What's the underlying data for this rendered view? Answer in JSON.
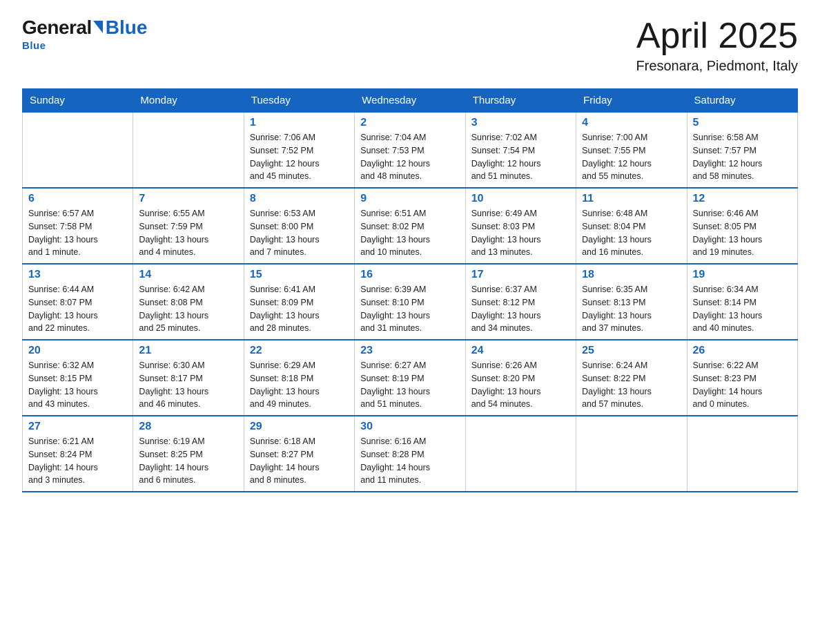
{
  "logo": {
    "general": "General",
    "blue": "Blue",
    "tagline": "Blue"
  },
  "header": {
    "month": "April 2025",
    "location": "Fresonara, Piedmont, Italy"
  },
  "weekdays": [
    "Sunday",
    "Monday",
    "Tuesday",
    "Wednesday",
    "Thursday",
    "Friday",
    "Saturday"
  ],
  "weeks": [
    [
      {
        "day": "",
        "info": ""
      },
      {
        "day": "",
        "info": ""
      },
      {
        "day": "1",
        "info": "Sunrise: 7:06 AM\nSunset: 7:52 PM\nDaylight: 12 hours\nand 45 minutes."
      },
      {
        "day": "2",
        "info": "Sunrise: 7:04 AM\nSunset: 7:53 PM\nDaylight: 12 hours\nand 48 minutes."
      },
      {
        "day": "3",
        "info": "Sunrise: 7:02 AM\nSunset: 7:54 PM\nDaylight: 12 hours\nand 51 minutes."
      },
      {
        "day": "4",
        "info": "Sunrise: 7:00 AM\nSunset: 7:55 PM\nDaylight: 12 hours\nand 55 minutes."
      },
      {
        "day": "5",
        "info": "Sunrise: 6:58 AM\nSunset: 7:57 PM\nDaylight: 12 hours\nand 58 minutes."
      }
    ],
    [
      {
        "day": "6",
        "info": "Sunrise: 6:57 AM\nSunset: 7:58 PM\nDaylight: 13 hours\nand 1 minute."
      },
      {
        "day": "7",
        "info": "Sunrise: 6:55 AM\nSunset: 7:59 PM\nDaylight: 13 hours\nand 4 minutes."
      },
      {
        "day": "8",
        "info": "Sunrise: 6:53 AM\nSunset: 8:00 PM\nDaylight: 13 hours\nand 7 minutes."
      },
      {
        "day": "9",
        "info": "Sunrise: 6:51 AM\nSunset: 8:02 PM\nDaylight: 13 hours\nand 10 minutes."
      },
      {
        "day": "10",
        "info": "Sunrise: 6:49 AM\nSunset: 8:03 PM\nDaylight: 13 hours\nand 13 minutes."
      },
      {
        "day": "11",
        "info": "Sunrise: 6:48 AM\nSunset: 8:04 PM\nDaylight: 13 hours\nand 16 minutes."
      },
      {
        "day": "12",
        "info": "Sunrise: 6:46 AM\nSunset: 8:05 PM\nDaylight: 13 hours\nand 19 minutes."
      }
    ],
    [
      {
        "day": "13",
        "info": "Sunrise: 6:44 AM\nSunset: 8:07 PM\nDaylight: 13 hours\nand 22 minutes."
      },
      {
        "day": "14",
        "info": "Sunrise: 6:42 AM\nSunset: 8:08 PM\nDaylight: 13 hours\nand 25 minutes."
      },
      {
        "day": "15",
        "info": "Sunrise: 6:41 AM\nSunset: 8:09 PM\nDaylight: 13 hours\nand 28 minutes."
      },
      {
        "day": "16",
        "info": "Sunrise: 6:39 AM\nSunset: 8:10 PM\nDaylight: 13 hours\nand 31 minutes."
      },
      {
        "day": "17",
        "info": "Sunrise: 6:37 AM\nSunset: 8:12 PM\nDaylight: 13 hours\nand 34 minutes."
      },
      {
        "day": "18",
        "info": "Sunrise: 6:35 AM\nSunset: 8:13 PM\nDaylight: 13 hours\nand 37 minutes."
      },
      {
        "day": "19",
        "info": "Sunrise: 6:34 AM\nSunset: 8:14 PM\nDaylight: 13 hours\nand 40 minutes."
      }
    ],
    [
      {
        "day": "20",
        "info": "Sunrise: 6:32 AM\nSunset: 8:15 PM\nDaylight: 13 hours\nand 43 minutes."
      },
      {
        "day": "21",
        "info": "Sunrise: 6:30 AM\nSunset: 8:17 PM\nDaylight: 13 hours\nand 46 minutes."
      },
      {
        "day": "22",
        "info": "Sunrise: 6:29 AM\nSunset: 8:18 PM\nDaylight: 13 hours\nand 49 minutes."
      },
      {
        "day": "23",
        "info": "Sunrise: 6:27 AM\nSunset: 8:19 PM\nDaylight: 13 hours\nand 51 minutes."
      },
      {
        "day": "24",
        "info": "Sunrise: 6:26 AM\nSunset: 8:20 PM\nDaylight: 13 hours\nand 54 minutes."
      },
      {
        "day": "25",
        "info": "Sunrise: 6:24 AM\nSunset: 8:22 PM\nDaylight: 13 hours\nand 57 minutes."
      },
      {
        "day": "26",
        "info": "Sunrise: 6:22 AM\nSunset: 8:23 PM\nDaylight: 14 hours\nand 0 minutes."
      }
    ],
    [
      {
        "day": "27",
        "info": "Sunrise: 6:21 AM\nSunset: 8:24 PM\nDaylight: 14 hours\nand 3 minutes."
      },
      {
        "day": "28",
        "info": "Sunrise: 6:19 AM\nSunset: 8:25 PM\nDaylight: 14 hours\nand 6 minutes."
      },
      {
        "day": "29",
        "info": "Sunrise: 6:18 AM\nSunset: 8:27 PM\nDaylight: 14 hours\nand 8 minutes."
      },
      {
        "day": "30",
        "info": "Sunrise: 6:16 AM\nSunset: 8:28 PM\nDaylight: 14 hours\nand 11 minutes."
      },
      {
        "day": "",
        "info": ""
      },
      {
        "day": "",
        "info": ""
      },
      {
        "day": "",
        "info": ""
      }
    ]
  ]
}
